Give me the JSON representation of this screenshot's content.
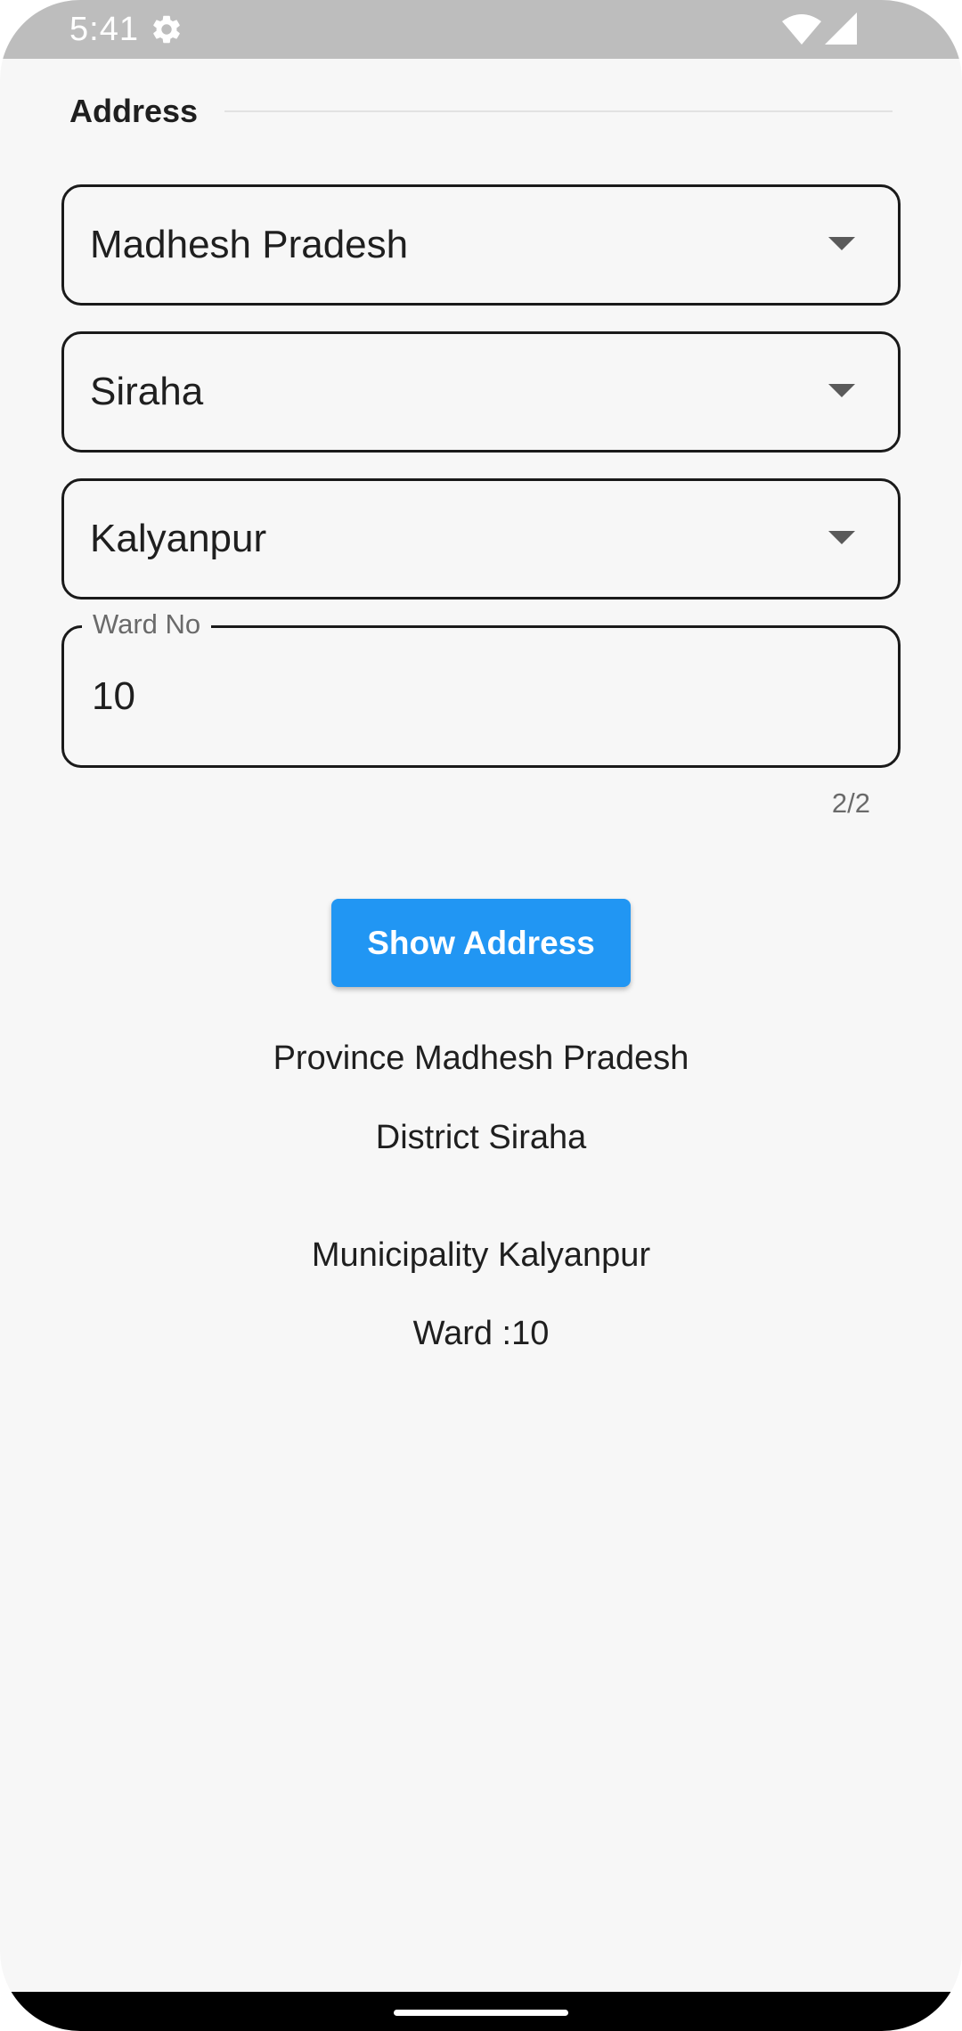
{
  "status_bar": {
    "time": "5:41",
    "icons": [
      "gear-icon",
      "wifi-icon",
      "signal-icon"
    ]
  },
  "section": {
    "title": "Address"
  },
  "fields": {
    "province": {
      "value": "Madhesh Pradesh",
      "icon": "dropdown-arrow-icon"
    },
    "district": {
      "value": "Siraha",
      "icon": "dropdown-arrow-icon"
    },
    "municipality": {
      "value": "Kalyanpur",
      "icon": "dropdown-arrow-icon"
    },
    "ward": {
      "label": "Ward No",
      "value": "10",
      "counter": "2/2"
    }
  },
  "button": {
    "label": "Show Address"
  },
  "result": {
    "province": "Province Madhesh Pradesh",
    "district": "District Siraha",
    "municipality": "Municipality Kalyanpur",
    "ward": "Ward :10"
  },
  "colors": {
    "accent": "#2196f3",
    "background": "#f7f7f7",
    "status_bar": "#bdbdbd"
  }
}
